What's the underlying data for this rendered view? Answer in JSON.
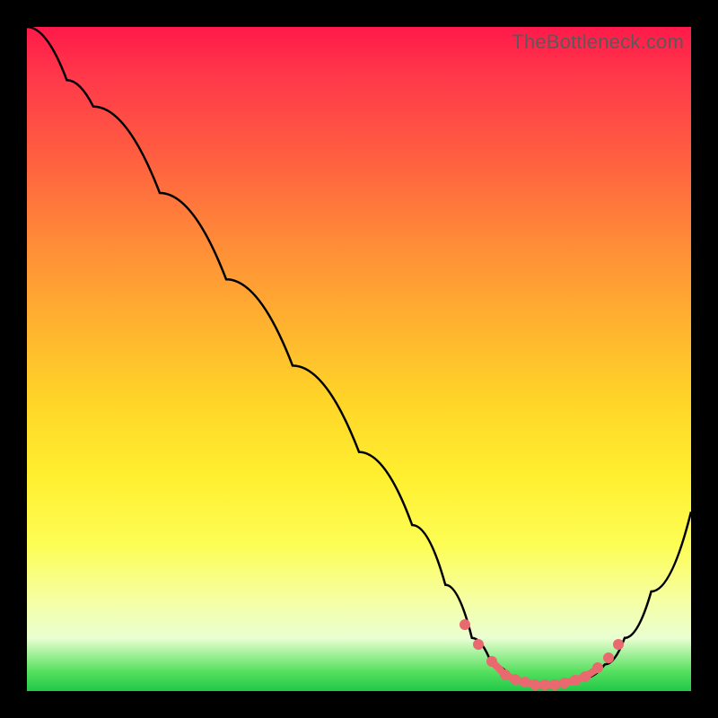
{
  "watermark": "TheBottleneck.com",
  "colors": {
    "dot": "#e86a6f",
    "curve": "#000000"
  },
  "chart_data": {
    "type": "line",
    "title": "",
    "xlabel": "",
    "ylabel": "",
    "x_range": [
      0,
      100
    ],
    "y_range": [
      0,
      100
    ],
    "curve": [
      {
        "x": 0,
        "y": 100
      },
      {
        "x": 6,
        "y": 92
      },
      {
        "x": 10,
        "y": 88
      },
      {
        "x": 20,
        "y": 75
      },
      {
        "x": 30,
        "y": 62
      },
      {
        "x": 40,
        "y": 49
      },
      {
        "x": 50,
        "y": 36
      },
      {
        "x": 58,
        "y": 25
      },
      {
        "x": 63,
        "y": 16
      },
      {
        "x": 67,
        "y": 8
      },
      {
        "x": 70,
        "y": 4
      },
      {
        "x": 73,
        "y": 2
      },
      {
        "x": 76,
        "y": 1
      },
      {
        "x": 80,
        "y": 1
      },
      {
        "x": 84,
        "y": 2
      },
      {
        "x": 87,
        "y": 4
      },
      {
        "x": 90,
        "y": 8
      },
      {
        "x": 94,
        "y": 15
      },
      {
        "x": 100,
        "y": 27
      }
    ],
    "highlighted_points": [
      {
        "x": 66,
        "y": 10
      },
      {
        "x": 68,
        "y": 7
      },
      {
        "x": 70,
        "y": 4.5
      },
      {
        "x": 72,
        "y": 2.5
      },
      {
        "x": 73.5,
        "y": 1.8
      },
      {
        "x": 75,
        "y": 1.3
      },
      {
        "x": 76.5,
        "y": 1
      },
      {
        "x": 78,
        "y": 1
      },
      {
        "x": 79.5,
        "y": 1
      },
      {
        "x": 81,
        "y": 1.2
      },
      {
        "x": 82.5,
        "y": 1.6
      },
      {
        "x": 84,
        "y": 2.2
      },
      {
        "x": 86,
        "y": 3.5
      },
      {
        "x": 87.5,
        "y": 5
      },
      {
        "x": 89,
        "y": 7
      }
    ],
    "highlighted_segment": {
      "x_start": 70,
      "x_end": 86
    }
  }
}
